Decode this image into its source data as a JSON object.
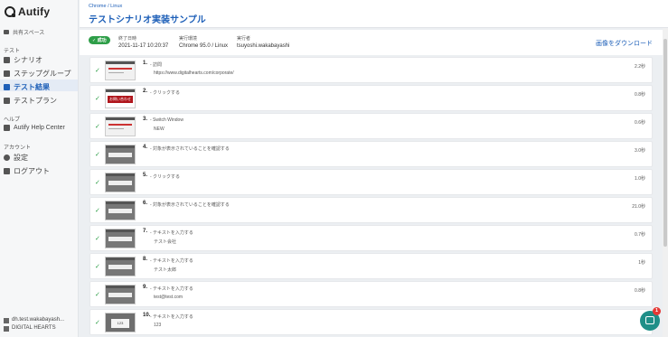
{
  "sidebar": {
    "logo_text": "Autify",
    "workspace": "共有スペース",
    "section_test": "テスト",
    "items": [
      {
        "label": "シナリオ"
      },
      {
        "label": "ステップグループ"
      },
      {
        "label": "テスト結果"
      },
      {
        "label": "テストプラン"
      }
    ],
    "section_help": "ヘルプ",
    "help_item": "Autify Help Center",
    "section_account": "アカウント",
    "settings": "設定",
    "logout": "ログアウト",
    "user_email": "dh.test.wakabayash...",
    "org": "DIGITAL HEARTS"
  },
  "header": {
    "breadcrumb": "Chrome / Linux",
    "title": "テストシナリオ実装サンプル"
  },
  "info": {
    "status": "成功",
    "finished_label": "終了日時",
    "finished_value": "2021-11-17 10:20:37",
    "env_label": "実行環境",
    "env_value": "Chrome 95.0 / Linux",
    "runner_label": "実行者",
    "runner_value": "tsuyoshi.wakabayashi",
    "download": "画像をダウンロード"
  },
  "steps": [
    {
      "num": "1.",
      "action": "- 訪問",
      "detail": "https://www.digitalhearts.com/corporate/",
      "duration": "2.2秒",
      "thumb": "white"
    },
    {
      "num": "2.",
      "action": "- クリックする",
      "detail": "",
      "duration": "0.8秒",
      "thumb": "red",
      "thumb_text": "お問い合わせ"
    },
    {
      "num": "3.",
      "action": "- Switch Window",
      "detail": "NEW",
      "duration": "0.6秒",
      "thumb": "white"
    },
    {
      "num": "4.",
      "action": "- 対象が表示されていることを確認する",
      "detail": "",
      "duration": "3.0秒",
      "thumb": "dark"
    },
    {
      "num": "5.",
      "action": "- クリックする",
      "detail": "",
      "duration": "1.0秒",
      "thumb": "dark"
    },
    {
      "num": "6.",
      "action": "- 対象が表示されていることを確認する",
      "detail": "",
      "duration": "21.0秒",
      "thumb": "dark"
    },
    {
      "num": "7.",
      "action": "- テキストを入力する",
      "detail": "テスト会社",
      "duration": "0.7秒",
      "thumb": "dark"
    },
    {
      "num": "8.",
      "action": "- テキストを入力する",
      "detail": "テスト太郎",
      "duration": "1秒",
      "thumb": "dark"
    },
    {
      "num": "9.",
      "action": "- テキストを入力する",
      "detail": "test@test.com",
      "duration": "0.8秒",
      "thumb": "dark"
    },
    {
      "num": "10.",
      "action": "- テキストを入力する",
      "detail": "123",
      "duration": "",
      "thumb": "dark2",
      "thumb_text": "123"
    }
  ],
  "chat": {
    "badge": "1"
  }
}
